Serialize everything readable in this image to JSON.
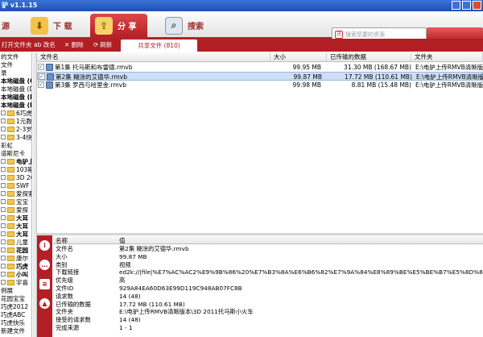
{
  "app": {
    "title": "驴 v1.1.15"
  },
  "toolbar": {
    "tabs": [
      {
        "label": "源",
        "icon": "resource-icon"
      },
      {
        "label": "下 载",
        "icon": "download-icon"
      },
      {
        "label": "分 享",
        "icon": "share-icon"
      },
      {
        "label": "搜索",
        "icon": "search-icon"
      }
    ],
    "search_placeholder": "搜索您要的资源"
  },
  "subbar": {
    "actions": [
      "打开文件夹",
      "ab 改名",
      "✕ 删除",
      "刷新"
    ],
    "share_tab": "共享文件 (810)"
  },
  "sidebar": {
    "items": [
      {
        "label": "的文件",
        "type": "text",
        "bold": false
      },
      {
        "label": "文件",
        "type": "text",
        "bold": false
      },
      {
        "label": "录",
        "type": "text",
        "bold": false
      },
      {
        "label": "本地磁盘 (C:",
        "type": "text",
        "bold": true
      },
      {
        "label": "本地磁盘 (Di",
        "type": "text",
        "bold": false
      },
      {
        "label": "本地磁盘 (E:",
        "type": "text",
        "bold": true
      },
      {
        "label": "本地磁盘 (I:",
        "type": "text",
        "bold": true
      },
      {
        "label": "6巧虎之",
        "type": "folder",
        "bold": false
      },
      {
        "label": "1元教程",
        "type": "folder",
        "bold": false
      },
      {
        "label": "2-3岁动",
        "type": "folder",
        "bold": false
      },
      {
        "label": "3-4快乐",
        "type": "folder",
        "bold": false
      },
      {
        "label": "彩虹",
        "type": "text",
        "bold": false
      },
      {
        "label": "道斯尼卡",
        "type": "text",
        "bold": false
      },
      {
        "label": "电驴上传",
        "type": "folder",
        "bold": true
      },
      {
        "label": "103期",
        "type": "folder",
        "bold": false
      },
      {
        "label": "3D 20",
        "type": "folder",
        "bold": false
      },
      {
        "label": "SWF",
        "type": "folder",
        "bold": false
      },
      {
        "label": "爱探索",
        "type": "folder",
        "bold": false
      },
      {
        "label": "宝宝",
        "type": "folder",
        "bold": false
      },
      {
        "label": "爱探",
        "type": "folder",
        "bold": false
      },
      {
        "label": "大耳",
        "type": "folder",
        "bold": true
      },
      {
        "label": "大耳",
        "type": "folder",
        "bold": true
      },
      {
        "label": "大耳",
        "type": "folder",
        "bold": true
      },
      {
        "label": "儿童",
        "type": "folder",
        "bold": false
      },
      {
        "label": "花园",
        "type": "folder",
        "bold": true
      },
      {
        "label": "康尔",
        "type": "folder",
        "bold": false
      },
      {
        "label": "巧虎",
        "type": "folder",
        "bold": true
      },
      {
        "label": "小叫",
        "type": "folder",
        "bold": true
      },
      {
        "label": "宇喜",
        "type": "folder",
        "bold": false
      },
      {
        "label": "例展",
        "type": "text",
        "bold": false
      },
      {
        "label": "花园宝宝",
        "type": "text",
        "bold": false
      },
      {
        "label": "巧虎2012",
        "type": "text",
        "bold": false
      },
      {
        "label": "巧虎ABC",
        "type": "text",
        "bold": false
      },
      {
        "label": "巧虎快乐",
        "type": "text",
        "bold": false
      },
      {
        "label": "新建文件",
        "type": "text",
        "bold": false
      }
    ]
  },
  "file_table": {
    "columns": [
      "文件名",
      "大小",
      "已传输的数据",
      "文件夹"
    ],
    "rows": [
      {
        "name": "第1集 托马斯和布雷德.rmvb",
        "size": "99.95 MB",
        "transferred": "31.30 MB (168.67 MB)",
        "folder": "E:\\电驴上传RMVB清晰版",
        "selected": false
      },
      {
        "name": "第2集 糊涂的艾德华.rmvb",
        "size": "99.87 MB",
        "transferred": "17.72 MB (110.61 MB)",
        "folder": "E:\\电驴上传RMVB清晰版",
        "selected": true
      },
      {
        "name": "第3集 罗西与哈里金.rmvb",
        "size": "99.98 MB",
        "transferred": "8.81 MB (15.48 MB)",
        "folder": "E:\\电驴上传RMVB清晰版",
        "selected": false
      }
    ]
  },
  "details": {
    "columns": [
      "名称",
      "值"
    ],
    "rows": [
      {
        "key": "文件名",
        "value": "第2集 糊涂的艾德华.rmvb"
      },
      {
        "key": "大小",
        "value": "99.87 MB"
      },
      {
        "key": "类别",
        "value": "视频"
      },
      {
        "key": "下载链接",
        "value": "ed2k://|file|%E7%AC%AC2%E9%9B%86%20%E7%B3%8A%E6%B6%82%E7%9A%84%E8%89%BE%E5%BE%B7%E5%8D%8E.rmvb|1..."
      },
      {
        "key": "优先级",
        "value": "高"
      },
      {
        "key": "文件ID",
        "value": "929A84EA60D63E99D119C948AB07FC8B"
      },
      {
        "key": "请求数",
        "value": "14 (48)"
      },
      {
        "key": "已传输的数据",
        "value": "17.72 MB (110.61 MB)"
      },
      {
        "key": "文件夹",
        "value": "E:\\电驴上传RMVB清晰版本\\3D 2011托马斯小火车"
      },
      {
        "key": "接受的请求数",
        "value": "14 (48)"
      },
      {
        "key": "完成来源",
        "value": "1 - 1"
      }
    ]
  },
  "side_actions": [
    "info-icon",
    "chat-icon",
    "list-icon",
    "upload-icon"
  ],
  "colors": {
    "accent": "#b11f24",
    "selection": "#cfe0f6",
    "titlebar": "#2a5fc4"
  }
}
